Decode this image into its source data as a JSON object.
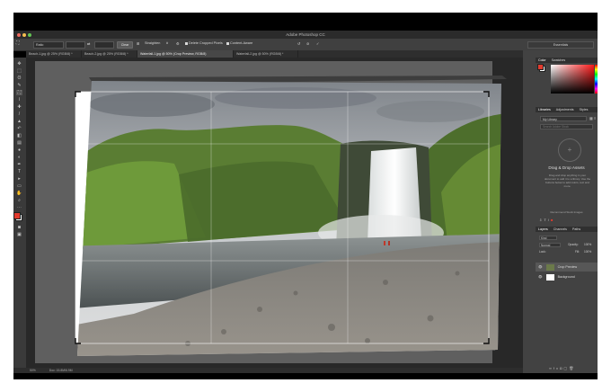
{
  "app": {
    "title": "Adobe Photoshop CC"
  },
  "options": {
    "ratio": "Ratio",
    "clear": "Clear",
    "straighten": "Straighten",
    "delete_cropped": "Delete Cropped Pixels",
    "content_aware": "Content-Aware",
    "right_field": "Essentials"
  },
  "tabs": [
    {
      "label": "Beach-1.jpg @ 25% (RGB/8) *"
    },
    {
      "label": "Beach-2.jpg @ 25% (RGB/8) *"
    },
    {
      "label": "Waterfall-1.jpg @ 50% (Crop Preview, RGB/8)"
    },
    {
      "label": "Waterfall-2.jpg @ 50% (RGB/8) *"
    }
  ],
  "status": {
    "zoom": "50%",
    "doc": "Doc: 15.8M/6.9M"
  },
  "panels": {
    "color": {
      "tabs": [
        "Color",
        "Swatches"
      ]
    },
    "libraries": {
      "tabs": [
        "Libraries",
        "Adjustments",
        "Styles"
      ],
      "library": "My Library",
      "search_placeholder": "Search Adobe Stock",
      "heading": "Drag & Drop Assets",
      "body": "Drag and drop anything in your document to add it to a library. Use the buttons below to add colors, text and more.",
      "footer": "Recommend Stock Images"
    },
    "layers": {
      "tabs": [
        "Layers",
        "Channels",
        "Paths"
      ],
      "kind": "Kind",
      "blend": "Normal",
      "opacity_label": "Opacity:",
      "opacity": "100%",
      "lock_label": "Lock:",
      "fill_label": "Fill:",
      "fill": "100%",
      "items": [
        {
          "name": "Crop Preview"
        },
        {
          "name": "Background"
        }
      ]
    }
  },
  "colors": {
    "accent": "#e23b2e",
    "panel": "#424242"
  }
}
